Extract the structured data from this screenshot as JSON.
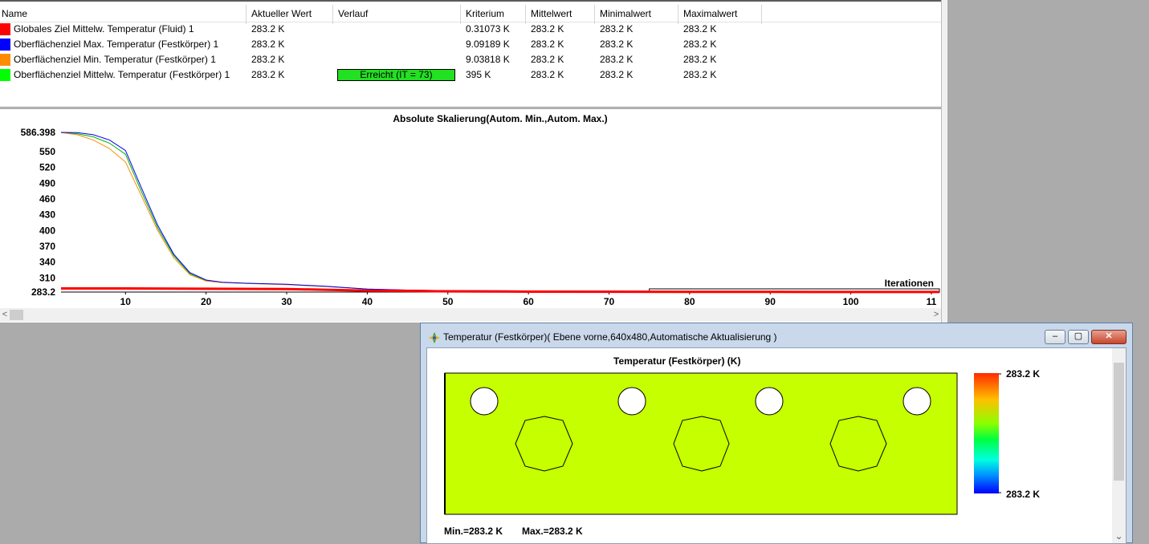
{
  "table": {
    "columns": [
      "Name",
      "Aktueller Wert",
      "Verlauf",
      "Kriterium",
      "Mittelwert",
      "Minimalwert",
      "Maximalwert"
    ],
    "rows": [
      {
        "color": "#ff0000",
        "name": "Globales Ziel Mittelw. Temperatur (Fluid) 1",
        "current": "283.2 K",
        "progress": "",
        "criterion": "0.31073 K",
        "mean": "283.2 K",
        "min": "283.2 K",
        "max": "283.2 K"
      },
      {
        "color": "#0000ff",
        "name": "Oberflächenziel Max. Temperatur (Festkörper) 1",
        "current": "283.2 K",
        "progress": "",
        "criterion": "9.09189 K",
        "mean": "283.2 K",
        "min": "283.2 K",
        "max": "283.2 K"
      },
      {
        "color": "#ff8c00",
        "name": "Oberflächenziel Min. Temperatur (Festkörper) 1",
        "current": "283.2 K",
        "progress": "",
        "criterion": "9.03818 K",
        "mean": "283.2 K",
        "min": "283.2 K",
        "max": "283.2 K"
      },
      {
        "color": "#00ff00",
        "name": "Oberflächenziel Mittelw. Temperatur (Festkörper) 1",
        "current": "283.2 K",
        "progress": "Erreicht (IT = 73)",
        "criterion": "395 K",
        "mean": "283.2 K",
        "min": "283.2 K",
        "max": "283.2 K"
      }
    ]
  },
  "chart_data": {
    "type": "line",
    "title": "Absolute Skalierung(Autom. Min.,Autom. Max.)",
    "xlabel": "Iterationen",
    "ylabel": "",
    "x_ticks": [
      "10",
      "20",
      "30",
      "40",
      "50",
      "60",
      "70",
      "80",
      "90",
      "100",
      "11"
    ],
    "y_ticks": [
      "586.398",
      "550",
      "520",
      "490",
      "460",
      "430",
      "400",
      "370",
      "340",
      "310",
      "283.2"
    ],
    "xlim": [
      2,
      111
    ],
    "ylim": [
      283.2,
      586.398
    ],
    "grid": false,
    "series": [
      {
        "name": "Globales Ziel Mittelw. Temperatur (Fluid) 1",
        "color": "#ff0000",
        "x": [
          2,
          10,
          20,
          30,
          40,
          50,
          60,
          70,
          80,
          90,
          100,
          111
        ],
        "y": [
          290,
          290,
          289.5,
          289,
          286,
          284.5,
          284,
          283.8,
          283.6,
          283.5,
          283.4,
          283.3
        ]
      },
      {
        "name": "Oberflächenziel Max. Temperatur (Festkörper) 1",
        "color": "#0000ff",
        "x": [
          2,
          4,
          6,
          8,
          10,
          12,
          14,
          16,
          18,
          20,
          22,
          25,
          30,
          35,
          40,
          45,
          50,
          60,
          70,
          80,
          90,
          100,
          111
        ],
        "y": [
          586.4,
          586,
          582,
          572,
          552,
          480,
          410,
          355,
          320,
          306,
          302,
          300,
          298,
          294,
          289,
          287,
          286,
          285.5,
          285,
          284.6,
          284.3,
          284,
          283.8
        ]
      },
      {
        "name": "Oberflächenziel Min. Temperatur (Festkörper) 1",
        "color": "#ff8c00",
        "x": [
          2,
          4,
          6,
          8,
          10,
          12,
          14,
          16,
          18,
          20,
          22,
          25,
          30,
          35,
          40,
          45,
          50,
          60,
          70,
          80,
          90,
          100,
          111
        ],
        "y": [
          586,
          582,
          572,
          556,
          530,
          465,
          400,
          348,
          316,
          304,
          301,
          299.5,
          297,
          293.5,
          288.5,
          286.5,
          285.8,
          285.3,
          284.8,
          284.4,
          284.1,
          283.9,
          283.7
        ]
      },
      {
        "name": "Oberflächenziel Mittelw. Temperatur (Festkörper) 1",
        "color": "#00b000",
        "x": [
          2,
          4,
          6,
          8,
          10,
          12,
          14,
          16,
          18,
          20,
          22,
          25,
          30,
          35,
          40,
          45,
          50,
          60,
          70,
          80,
          90,
          100,
          111
        ],
        "y": [
          586.2,
          584,
          578,
          566,
          545,
          473,
          405,
          352,
          318,
          305,
          301.5,
          299.8,
          297.5,
          293.8,
          288.8,
          286.8,
          285.9,
          285.4,
          284.9,
          284.5,
          284.2,
          283.95,
          283.75
        ]
      }
    ]
  },
  "window": {
    "title": "Temperatur (Festkörper)( Ebene vorne,640x480,Automatische Aktualisierung )",
    "plot_title": "Temperatur (Festkörper) (K)",
    "legend_max": "283.2 K",
    "legend_min": "283.2 K",
    "min_label": "Min.=283.2 K",
    "max_label": "Max.=283.2 K",
    "fill_color": "#c5ff00",
    "buttons": {
      "minimize": "–",
      "restore": "▢",
      "close": "✕"
    }
  },
  "icons": {
    "scroll_left": "<",
    "scroll_right": ">",
    "scroll_down": "⌄",
    "app": "solidworks-flow-icon"
  }
}
